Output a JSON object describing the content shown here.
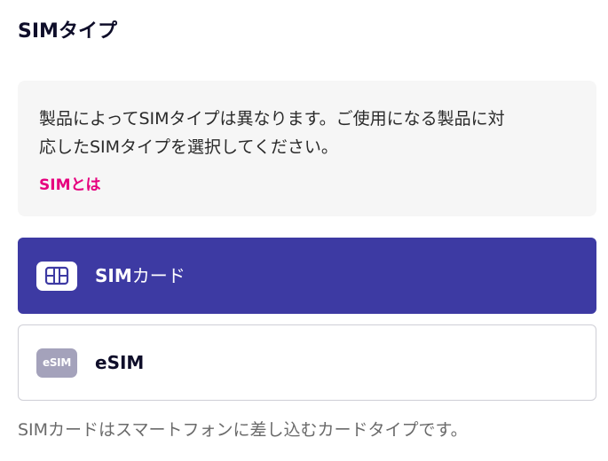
{
  "section": {
    "title_latin": "SIM",
    "title_kana": "タイプ"
  },
  "info": {
    "line1": "製品によってSIMタイプは異なります。ご使用になる製品に対",
    "line2": "応したSIMタイプを選択してください。",
    "link_label": "SIMとは"
  },
  "options": [
    {
      "id": "sim-card",
      "label_latin": "SIM",
      "label_kana": "カード",
      "icon": "sim-card-icon",
      "selected": true
    },
    {
      "id": "esim",
      "label_latin": "eSIM",
      "label_kana": "",
      "icon": "esim-icon",
      "icon_text": "eSIM",
      "selected": false
    }
  ],
  "footnote": "SIMカードはスマートフォンに差し込むカードタイプです。",
  "colors": {
    "accent": "#3d3aa3",
    "link": "#e6007e",
    "info_bg": "#f6f6f6",
    "esim_icon_bg": "#a4a2bb"
  }
}
